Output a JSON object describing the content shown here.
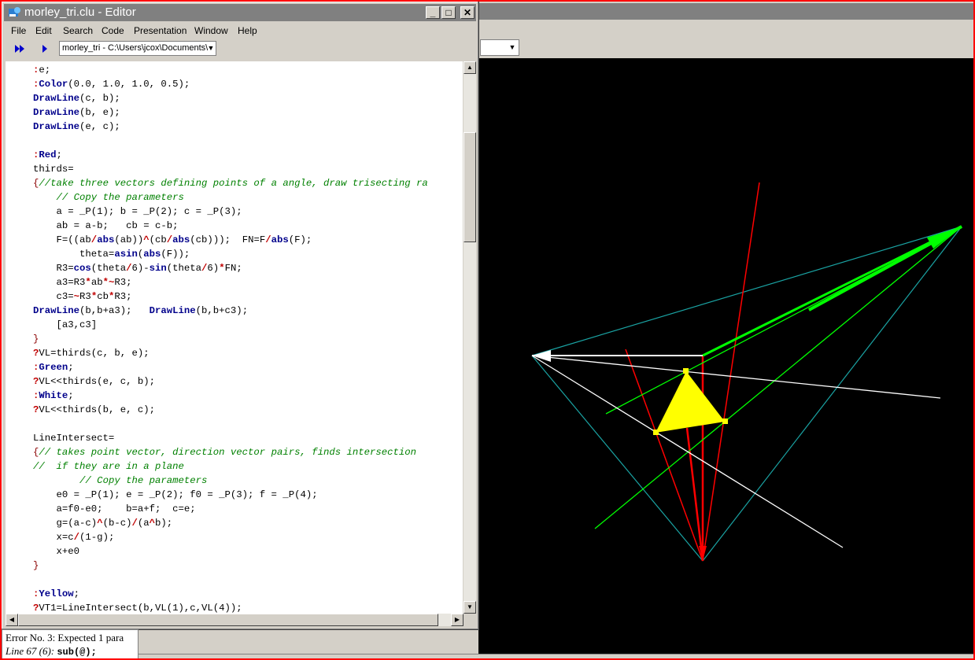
{
  "editor": {
    "title": "morley_tri.clu - Editor",
    "menu": [
      "File",
      "Edit",
      "Search",
      "Code",
      "Presentation",
      "Window",
      "Help"
    ],
    "path_combo": "morley_tri - C:\\Users\\jcox\\Documents\\",
    "buttons": {
      "minimize": "_",
      "maximize": "□",
      "close": "✕"
    }
  },
  "code": [
    ":e;",
    ":Color(0.0, 1.0, 1.0, 0.5);",
    "DrawLine(c, b);",
    "DrawLine(b, e);",
    "DrawLine(e, c);",
    "",
    ":Red;",
    "thirds=",
    "{//take three vectors defining points of a angle, draw trisecting ra",
    "    // Copy the parameters",
    "    a = _P(1); b = _P(2); c = _P(3);",
    "    ab = a-b;   cb = c-b;",
    "    F=((ab/abs(ab))^(cb/abs(cb)));  FN=F/abs(F);",
    "        theta=asin(abs(F));",
    "    R3=cos(theta/6)-sin(theta/6)*FN;",
    "    a3=R3*ab*~R3;",
    "    c3=~R3*cb*R3;",
    "DrawLine(b,b+a3);   DrawLine(b,b+c3);",
    "    [a3,c3]",
    "}",
    "?VL=thirds(c, b, e);",
    ":Green;",
    "?VL<<thirds(e, c, b);",
    ":White;",
    "?VL<<thirds(b, e, c);",
    "",
    "LineIntersect=",
    "{// takes point vector, direction vector pairs, finds intersection",
    "//  if they are in a plane",
    "        // Copy the parameters",
    "    e0 = _P(1); e = _P(2); f0 = _P(3); f = _P(4);",
    "    a=f0-e0;    b=a+f;  c=e;",
    "    g=(a-c)^(b-c)/(a^b);",
    "    x=c/(1-g);",
    "    x+e0",
    "}",
    "",
    ":Yellow;",
    "?VT1=LineIntersect(b,VL(1),c,VL(4));"
  ],
  "error": {
    "line1": "Error No. 3: Expected 1 para",
    "line2_prefix": "Line 67 (6):",
    "line2_code": "sub(@);"
  },
  "colors": {
    "cyan_line": "#1aa3a3",
    "red": "#ff0000",
    "green": "#00ff00",
    "white": "#ffffff",
    "yellow": "#ffff00"
  }
}
